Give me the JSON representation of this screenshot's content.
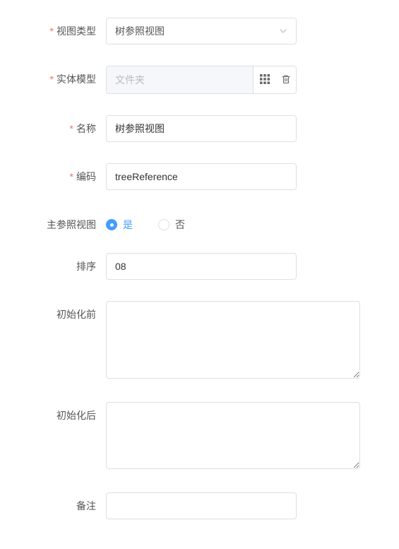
{
  "fields": {
    "viewType": {
      "label": "视图类型",
      "value": "树参照视图"
    },
    "entityModel": {
      "label": "实体模型",
      "placeholder": "文件夹"
    },
    "name": {
      "label": "名称",
      "value": "树参照视图"
    },
    "code": {
      "label": "编码",
      "value": "treeReference"
    },
    "mainRefView": {
      "label": "主参照视图",
      "options": {
        "yes": "是",
        "no": "否"
      },
      "selected": "yes"
    },
    "order": {
      "label": "排序",
      "value": "08"
    },
    "beforeInit": {
      "label": "初始化前",
      "value": ""
    },
    "afterInit": {
      "label": "初始化后",
      "value": ""
    },
    "remark": {
      "label": "备注",
      "value": ""
    }
  },
  "icons": {
    "chevronDown": "chevron-down-icon",
    "grid": "grid-icon",
    "trash": "trash-icon"
  }
}
